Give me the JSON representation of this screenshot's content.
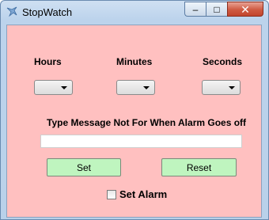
{
  "window": {
    "title": "StopWatch",
    "controls": {
      "minimize": "–",
      "maximize": "□",
      "close": "✕"
    }
  },
  "labels": {
    "hours": "Hours",
    "minutes": "Minutes",
    "seconds": "Seconds",
    "message": "Type Message Not For When Alarm Goes off"
  },
  "fields": {
    "hours_value": "",
    "minutes_value": "",
    "seconds_value": "",
    "message_value": ""
  },
  "buttons": {
    "set": "Set",
    "reset": "Reset"
  },
  "alarm": {
    "label": "Set Alarm",
    "checked": false
  },
  "colors": {
    "client_background": "#ffc0c0",
    "button_background": "#bff5bf"
  }
}
